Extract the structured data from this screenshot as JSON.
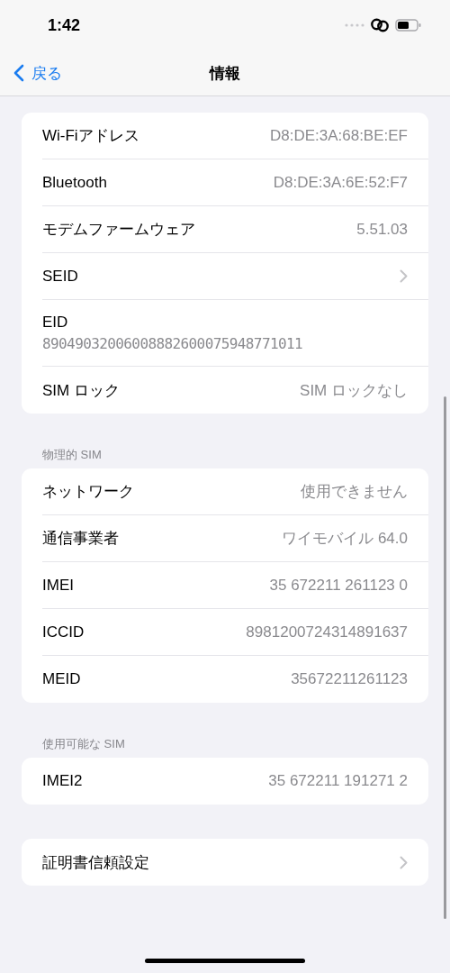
{
  "status_bar": {
    "time": "1:42"
  },
  "nav": {
    "back": "戻る",
    "title": "情報"
  },
  "sections": [
    {
      "rows": [
        {
          "kind": "value",
          "label": "Wi-Fiアドレス",
          "value": "D8:DE:3A:68:BE:EF"
        },
        {
          "kind": "value",
          "label": "Bluetooth",
          "value": "D8:DE:3A:6E:52:F7"
        },
        {
          "kind": "value",
          "label": "モデムファームウェア",
          "value": "5.51.03"
        },
        {
          "kind": "link",
          "label": "SEID"
        },
        {
          "kind": "stacked",
          "label": "EID",
          "value": "89049032006008882600075948771011"
        },
        {
          "kind": "value",
          "label": "SIM ロック",
          "value": "SIM ロックなし"
        }
      ]
    },
    {
      "header": "物理的 SIM",
      "rows": [
        {
          "kind": "value",
          "label": "ネットワーク",
          "value": "使用できません"
        },
        {
          "kind": "value",
          "label": "通信事業者",
          "value": "ワイモバイル 64.0"
        },
        {
          "kind": "value",
          "label": "IMEI",
          "value": "35 672211 261123 0"
        },
        {
          "kind": "value",
          "label": "ICCID",
          "value": "8981200724314891637"
        },
        {
          "kind": "value",
          "label": "MEID",
          "value": "35672211261123"
        }
      ]
    },
    {
      "header": "使用可能な SIM",
      "rows": [
        {
          "kind": "value",
          "label": "IMEI2",
          "value": "35 672211 191271 2"
        }
      ]
    },
    {
      "rows": [
        {
          "kind": "link",
          "label": "証明書信頼設定"
        }
      ]
    }
  ]
}
